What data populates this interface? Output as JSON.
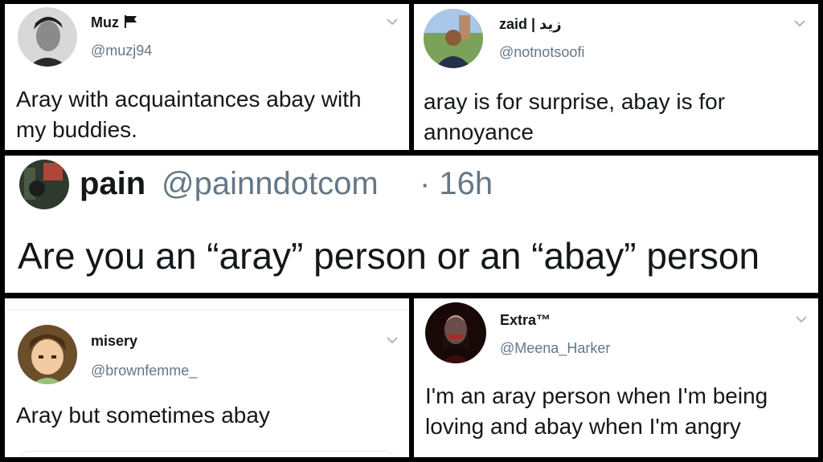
{
  "tweets": [
    {
      "name": "Muz",
      "handle": "@muzj94",
      "text": "Aray with acquaintances abay with my buddies.",
      "flag_icon": "flag-icon"
    },
    {
      "name": "zaid | زید",
      "handle": "@notnotsoofi",
      "text": "aray is for surprise, abay is for annoyance"
    },
    {
      "name": "pain",
      "handle": "@painndotcom",
      "time": "· 16h",
      "text": "Are you an “aray” person or an “abay” person"
    },
    {
      "name": "misery",
      "handle": "@brownfemme_",
      "text": "Aray but sometimes abay"
    },
    {
      "name": "Extra™",
      "handle": "@Meena_Harker",
      "text": "I'm an aray person when I'm being loving and abay when I'm angry"
    }
  ],
  "colors": {
    "name": "#14171a",
    "handle": "#657786",
    "chevron": "#aab8c2",
    "border": "#000000"
  }
}
